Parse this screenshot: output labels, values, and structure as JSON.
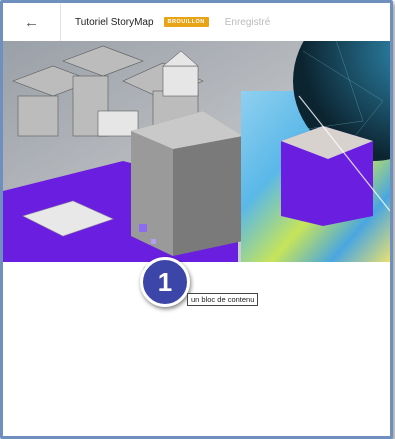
{
  "topbar": {
    "back_icon": "←",
    "title": "Tutoriel StoryMap",
    "status_badge": "BROUILLON",
    "saved_label": "Enregistré"
  },
  "callout": {
    "number": "1",
    "tooltip": "un bloc de contenu"
  },
  "colors": {
    "badge": "#e8a317",
    "marker": "#3c46a8",
    "purple": "#6a1fe0"
  }
}
